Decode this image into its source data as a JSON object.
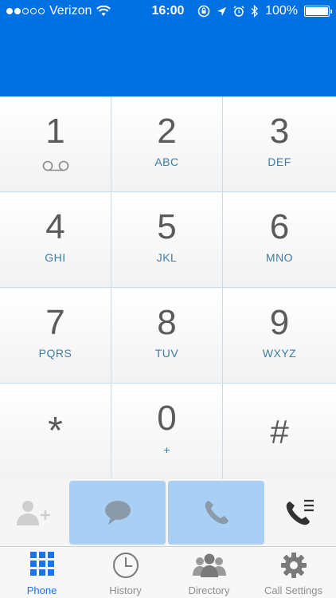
{
  "status_bar": {
    "carrier": "Verizon",
    "time": "16:00",
    "battery": "100%",
    "signal_bars_filled": 2,
    "signal_bars_total": 5
  },
  "keypad": {
    "keys": [
      {
        "digit": "1",
        "letters": ""
      },
      {
        "digit": "2",
        "letters": "ABC"
      },
      {
        "digit": "3",
        "letters": "DEF"
      },
      {
        "digit": "4",
        "letters": "GHI"
      },
      {
        "digit": "5",
        "letters": "JKL"
      },
      {
        "digit": "6",
        "letters": "MNO"
      },
      {
        "digit": "7",
        "letters": "PQRS"
      },
      {
        "digit": "8",
        "letters": "TUV"
      },
      {
        "digit": "9",
        "letters": "WXYZ"
      },
      {
        "digit": "*",
        "letters": ""
      },
      {
        "digit": "0",
        "letters": "+"
      },
      {
        "digit": "#",
        "letters": ""
      }
    ]
  },
  "actions": {
    "add_contact_icon": "add-contact-icon",
    "message_icon": "chat-bubble-icon",
    "call_icon": "phone-handset-icon",
    "call_list_icon": "phone-list-icon"
  },
  "tabs": [
    {
      "label": "Phone",
      "icon": "keypad-grid-icon",
      "active": true
    },
    {
      "label": "History",
      "icon": "clock-icon",
      "active": false
    },
    {
      "label": "Directory",
      "icon": "people-icon",
      "active": false
    },
    {
      "label": "Call Settings",
      "icon": "gear-icon",
      "active": false
    }
  ],
  "colors": {
    "header_blue": "#0071e3",
    "accent_blue": "#1a73e8",
    "letters_blue": "#3b7ea6",
    "action_blue": "#a9cff5"
  }
}
